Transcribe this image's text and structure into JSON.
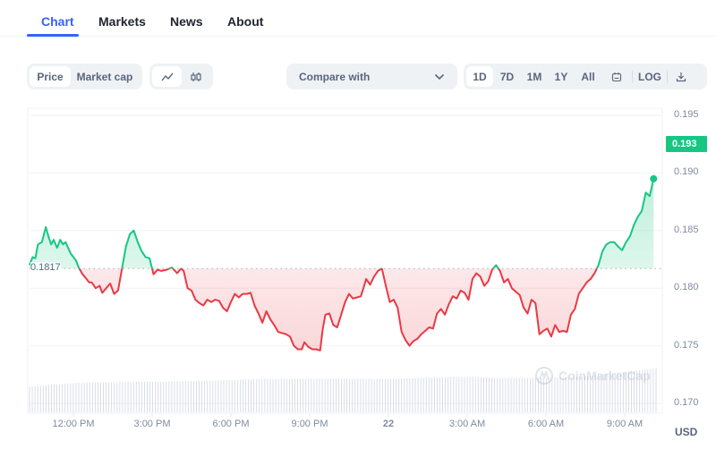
{
  "tabs": [
    {
      "label": "Chart",
      "active": true
    },
    {
      "label": "Markets",
      "active": false
    },
    {
      "label": "News",
      "active": false
    },
    {
      "label": "About",
      "active": false
    }
  ],
  "toolbar": {
    "metric_options": [
      {
        "label": "Price",
        "active": true
      },
      {
        "label": "Market cap",
        "active": false
      }
    ],
    "chart_types": [
      {
        "icon": "line-chart-icon",
        "active": true
      },
      {
        "icon": "candlestick-icon",
        "active": false
      }
    ],
    "compare_label": "Compare with",
    "ranges": [
      {
        "label": "1D",
        "active": true
      },
      {
        "label": "7D",
        "active": false
      },
      {
        "label": "1M",
        "active": false
      },
      {
        "label": "1Y",
        "active": false
      },
      {
        "label": "All",
        "active": false
      }
    ],
    "calendar_icon": "calendar-icon",
    "log_label": "LOG",
    "download_icon": "download-icon"
  },
  "colors": {
    "accent": "#3861fb",
    "up": "#16c784",
    "down": "#ea3943",
    "axis_text": "#808a9d",
    "grid": "#f0f2f5",
    "volume": "#cfd6e4"
  },
  "watermark": "CoinMarketCap",
  "chart_data": {
    "type": "line",
    "title": "",
    "xlabel": "",
    "ylabel": "USD",
    "currency": "USD",
    "baseline_value": 0.1817,
    "baseline_label": "0.1817",
    "current_price": 0.193,
    "current_price_label": "0.193",
    "ylim": [
      0.1685,
      0.1962
    ],
    "yticks": [
      0.17,
      0.175,
      0.18,
      0.185,
      0.19,
      0.195
    ],
    "ytick_labels": [
      "0.170",
      "0.175",
      "0.180",
      "0.185",
      "0.190",
      "0.195"
    ],
    "x_unit": "hours since 12:00 PM",
    "xlim": [
      -1.67,
      22.2
    ],
    "xticks": [
      0,
      3,
      6,
      9,
      12,
      15,
      18,
      21
    ],
    "xtick_labels": [
      "12:00 PM",
      "3:00 PM",
      "6:00 PM",
      "9:00 PM",
      "22",
      "3:00 AM",
      "6:00 AM",
      "9:00 AM"
    ],
    "xtick_bold": [
      false,
      false,
      false,
      false,
      true,
      false,
      false,
      false
    ],
    "grid": true,
    "x": [
      -1.67,
      -1.55,
      -1.45,
      -1.35,
      -1.2,
      -1.05,
      -0.95,
      -0.85,
      -0.75,
      -0.62,
      -0.5,
      -0.4,
      -0.3,
      -0.2,
      -0.1,
      0,
      0.1,
      0.2,
      0.35,
      0.5,
      0.6,
      0.7,
      0.85,
      1.0,
      1.1,
      1.25,
      1.4,
      1.55,
      1.7,
      1.85,
      2.0,
      2.15,
      2.3,
      2.45,
      2.6,
      2.75,
      2.9,
      3.05,
      3.2,
      3.35,
      3.55,
      3.75,
      3.95,
      4.1,
      4.2,
      4.35,
      4.5,
      4.65,
      4.8,
      4.95,
      5.1,
      5.25,
      5.4,
      5.55,
      5.7,
      5.85,
      6.0,
      6.15,
      6.3,
      6.45,
      6.6,
      6.75,
      6.9,
      7.05,
      7.2,
      7.35,
      7.5,
      7.65,
      7.8,
      7.95,
      8.1,
      8.25,
      8.4,
      8.55,
      8.7,
      8.8,
      8.95,
      9.1,
      9.25,
      9.4,
      9.5,
      9.6,
      9.75,
      9.9,
      10.05,
      10.2,
      10.35,
      10.5,
      10.65,
      10.8,
      10.95,
      11.05,
      11.15,
      11.3,
      11.45,
      11.6,
      11.75,
      11.9,
      12.05,
      12.2,
      12.35,
      12.5,
      12.65,
      12.8,
      12.95,
      13.1,
      13.25,
      13.4,
      13.55,
      13.7,
      13.85,
      14.0,
      14.15,
      14.3,
      14.45,
      14.6,
      14.75,
      14.9,
      15.05,
      15.2,
      15.35,
      15.5,
      15.65,
      15.8,
      15.95,
      16.1,
      16.25,
      16.4,
      16.55,
      16.7,
      16.85,
      17.0,
      17.15,
      17.3,
      17.45,
      17.6,
      17.75,
      17.9,
      18.05,
      18.2,
      18.35,
      18.5,
      18.65,
      18.8,
      18.95,
      19.1,
      19.25,
      19.4,
      19.55,
      19.7,
      19.85,
      20.0,
      20.15,
      20.3,
      20.45,
      20.6,
      20.75,
      20.9,
      21.05,
      21.2,
      21.35,
      21.5,
      21.65,
      21.8,
      21.95,
      22.1
    ],
    "values": [
      0.182,
      0.1827,
      0.1826,
      0.1838,
      0.184,
      0.1853,
      0.1845,
      0.1838,
      0.1842,
      0.1835,
      0.1842,
      0.1838,
      0.184,
      0.1835,
      0.183,
      0.1827,
      0.1824,
      0.1818,
      0.1812,
      0.1808,
      0.1805,
      0.1805,
      0.18,
      0.1802,
      0.1796,
      0.18,
      0.1804,
      0.1795,
      0.1798,
      0.1817,
      0.1836,
      0.1847,
      0.185,
      0.184,
      0.1832,
      0.1827,
      0.1826,
      0.1812,
      0.1816,
      0.1815,
      0.1816,
      0.1818,
      0.1813,
      0.1817,
      0.1815,
      0.18,
      0.1798,
      0.179,
      0.1787,
      0.1785,
      0.179,
      0.1788,
      0.179,
      0.1789,
      0.1783,
      0.178,
      0.1788,
      0.1795,
      0.1792,
      0.1795,
      0.1795,
      0.1796,
      0.1785,
      0.1778,
      0.177,
      0.178,
      0.1773,
      0.1768,
      0.1762,
      0.1761,
      0.176,
      0.1758,
      0.175,
      0.1747,
      0.1747,
      0.1753,
      0.1749,
      0.1747,
      0.1747,
      0.1746,
      0.1765,
      0.1777,
      0.1778,
      0.1768,
      0.1766,
      0.1777,
      0.1788,
      0.1795,
      0.1791,
      0.1792,
      0.1793,
      0.18,
      0.1808,
      0.1803,
      0.181,
      0.1815,
      0.1817,
      0.1802,
      0.1788,
      0.179,
      0.1783,
      0.1762,
      0.1755,
      0.175,
      0.1754,
      0.1756,
      0.176,
      0.1763,
      0.1766,
      0.1765,
      0.1778,
      0.1782,
      0.1777,
      0.1786,
      0.1793,
      0.1791,
      0.1798,
      0.1796,
      0.179,
      0.1808,
      0.1813,
      0.181,
      0.1802,
      0.1806,
      0.1816,
      0.182,
      0.1815,
      0.1805,
      0.1808,
      0.18,
      0.1797,
      0.1794,
      0.1783,
      0.1778,
      0.179,
      0.1787,
      0.176,
      0.1763,
      0.1765,
      0.1758,
      0.1768,
      0.1762,
      0.1763,
      0.1762,
      0.1777,
      0.1782,
      0.1795,
      0.18,
      0.1805,
      0.1808,
      0.1813,
      0.182,
      0.1832,
      0.1838,
      0.184,
      0.184,
      0.1836,
      0.1833,
      0.184,
      0.1845,
      0.1855,
      0.1862,
      0.1867,
      0.1883,
      0.188,
      0.1895,
      0.1902,
      0.1908,
      0.1904,
      0.191,
      0.1912,
      0.191,
      0.193
    ],
    "volume": {
      "description": "relative volume bars, slowly rising across the day",
      "values": [
        0.55,
        0.6,
        0.64,
        0.64,
        0.66,
        0.66,
        0.67,
        0.68,
        0.7,
        0.72,
        0.72,
        0.72,
        0.72,
        0.72,
        0.72,
        0.74,
        0.76,
        0.76,
        0.74,
        0.74,
        0.74,
        0.76,
        0.82,
        0.88,
        0.95
      ]
    }
  }
}
